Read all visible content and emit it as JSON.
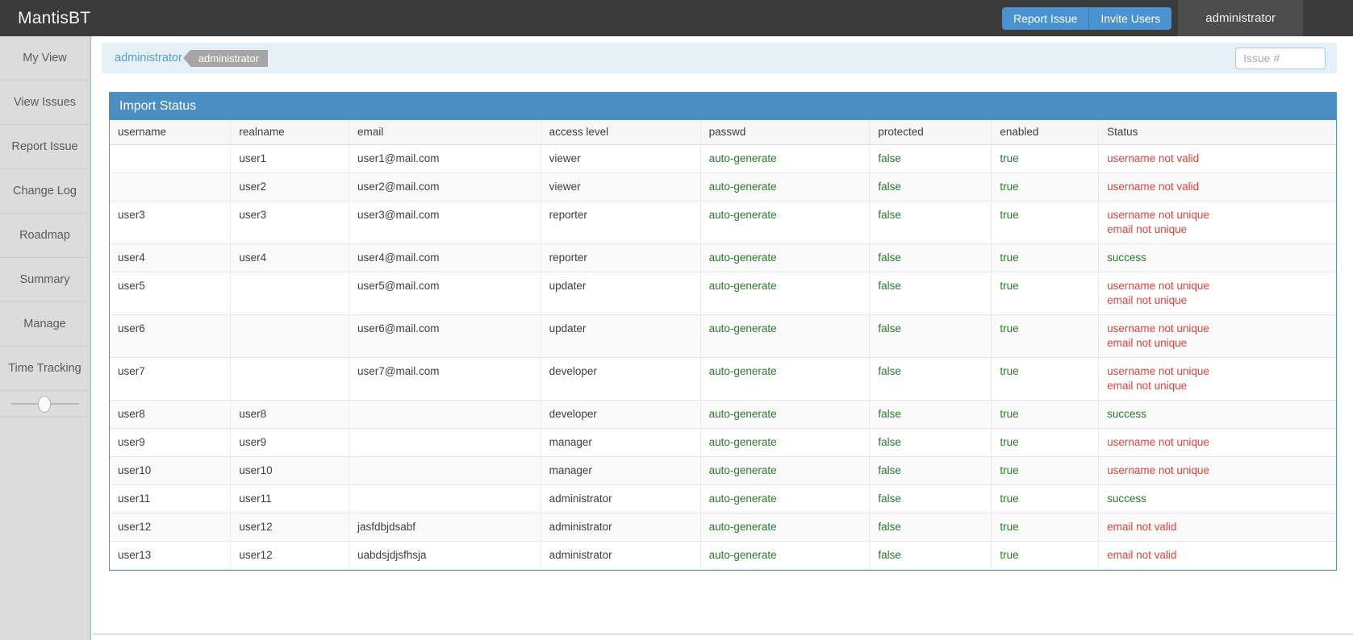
{
  "navbar": {
    "brand": "MantisBT",
    "report_issue_label": "Report Issue",
    "invite_users_label": "Invite Users",
    "user_label": "administrator",
    "button_color": "#4b92d0",
    "bg_color": "#3b3b3b"
  },
  "sidebar": {
    "items": [
      {
        "label": "My View"
      },
      {
        "label": "View Issues"
      },
      {
        "label": "Report Issue"
      },
      {
        "label": "Change Log"
      },
      {
        "label": "Roadmap"
      },
      {
        "label": "Summary"
      },
      {
        "label": "Manage"
      },
      {
        "label": "Time Tracking"
      }
    ]
  },
  "breadcrumb": {
    "link": "administrator",
    "badge": "administrator"
  },
  "search": {
    "issue_placeholder": "Issue #",
    "issue_value": ""
  },
  "widget": {
    "title": "Import Status",
    "header_color": "#4b8ec1"
  },
  "table": {
    "columns": [
      "username",
      "realname",
      "email",
      "access level",
      "passwd",
      "protected",
      "enabled",
      "Status"
    ],
    "rows": [
      {
        "username": "",
        "realname": "user1",
        "email": "user1@mail.com",
        "access_level": "viewer",
        "passwd": "auto-generate",
        "protected": "false",
        "enabled": "true",
        "status": [
          "username not valid"
        ],
        "status_kind": "error"
      },
      {
        "username": "",
        "realname": "user2",
        "email": "user2@mail.com",
        "access_level": "viewer",
        "passwd": "auto-generate",
        "protected": "false",
        "enabled": "true",
        "status": [
          "username not valid"
        ],
        "status_kind": "error"
      },
      {
        "username": "user3",
        "realname": "user3",
        "email": "user3@mail.com",
        "access_level": "reporter",
        "passwd": "auto-generate",
        "protected": "false",
        "enabled": "true",
        "status": [
          "username not unique",
          "email not unique"
        ],
        "status_kind": "error"
      },
      {
        "username": "user4",
        "realname": "user4",
        "email": "user4@mail.com",
        "access_level": "reporter",
        "passwd": "auto-generate",
        "protected": "false",
        "enabled": "true",
        "status": [
          "success"
        ],
        "status_kind": "success"
      },
      {
        "username": "user5",
        "realname": "",
        "email": "user5@mail.com",
        "access_level": "updater",
        "passwd": "auto-generate",
        "protected": "false",
        "enabled": "true",
        "status": [
          "username not unique",
          "email not unique"
        ],
        "status_kind": "error"
      },
      {
        "username": "user6",
        "realname": "",
        "email": "user6@mail.com",
        "access_level": "updater",
        "passwd": "auto-generate",
        "protected": "false",
        "enabled": "true",
        "status": [
          "username not unique",
          "email not unique"
        ],
        "status_kind": "error"
      },
      {
        "username": "user7",
        "realname": "",
        "email": "user7@mail.com",
        "access_level": "developer",
        "passwd": "auto-generate",
        "protected": "false",
        "enabled": "true",
        "status": [
          "username not unique",
          "email not unique"
        ],
        "status_kind": "error"
      },
      {
        "username": "user8",
        "realname": "user8",
        "email": "",
        "access_level": "developer",
        "passwd": "auto-generate",
        "protected": "false",
        "enabled": "true",
        "status": [
          "success"
        ],
        "status_kind": "success"
      },
      {
        "username": "user9",
        "realname": "user9",
        "email": "",
        "access_level": "manager",
        "passwd": "auto-generate",
        "protected": "false",
        "enabled": "true",
        "status": [
          "username not unique"
        ],
        "status_kind": "error"
      },
      {
        "username": "user10",
        "realname": "user10",
        "email": "",
        "access_level": "manager",
        "passwd": "auto-generate",
        "protected": "false",
        "enabled": "true",
        "status": [
          "username not unique"
        ],
        "status_kind": "error"
      },
      {
        "username": "user11",
        "realname": "user11",
        "email": "",
        "access_level": "administrator",
        "passwd": "auto-generate",
        "protected": "false",
        "enabled": "true",
        "status": [
          "success"
        ],
        "status_kind": "success"
      },
      {
        "username": "user12",
        "realname": "user12",
        "email": "jasfdbjdsabf",
        "access_level": "administrator",
        "passwd": "auto-generate",
        "protected": "false",
        "enabled": "true",
        "status": [
          "email not valid"
        ],
        "status_kind": "error"
      },
      {
        "username": "user13",
        "realname": "user12",
        "email": "uabdsjdjsfhsja",
        "access_level": "administrator",
        "passwd": "auto-generate",
        "protected": "false",
        "enabled": "true",
        "status": [
          "email not valid"
        ],
        "status_kind": "error"
      }
    ]
  },
  "colors": {
    "success_text": "#2a7a2a",
    "error_text": "#e8403a",
    "accent": "#4b8ec1"
  }
}
